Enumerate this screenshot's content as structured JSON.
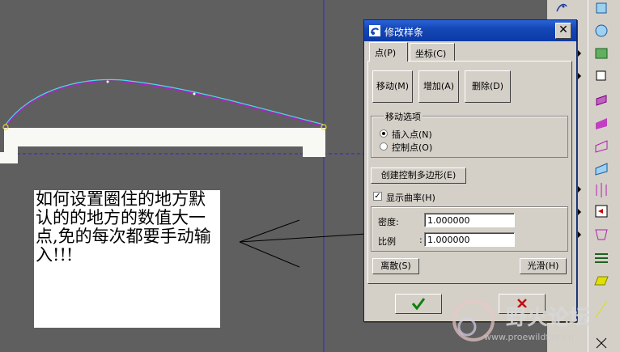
{
  "dialog": {
    "title": "修改样条",
    "tabs": [
      {
        "label": "点(P)"
      },
      {
        "label": "坐标(C)"
      }
    ],
    "buttons": {
      "move": "移动(M)",
      "add": "增加(A)",
      "delete": "删除(D)"
    },
    "move_options": {
      "label": "移动选项",
      "insert_point": "插入点(N)",
      "control_point": "控制点(O)",
      "selected": "insert_point"
    },
    "create_polygon": "创建控制多边形(E)",
    "show_curvature": {
      "label": "显示曲率(H)",
      "checked": true
    },
    "density": {
      "label": "密度:",
      "value": "1.000000"
    },
    "ratio": {
      "label": "比例",
      "colon": ":",
      "value": "1.000000"
    },
    "discrete": "离散(S)",
    "smooth": "光滑(H)",
    "ok_icon": "checkmark-icon",
    "cancel_icon": "x-icon"
  },
  "note": {
    "text": "如何设置圈住的地方默认的的地方的数值大一点,免的每次都要手动输入!!!"
  },
  "watermark": {
    "name": "野火论坛",
    "url": "www.proewildfire.cn"
  },
  "colors": {
    "curve": "#b01fd0",
    "curvature": "#4fd7e8",
    "axis": "#2a2ad0",
    "title_bar": "#0b3aa8"
  }
}
